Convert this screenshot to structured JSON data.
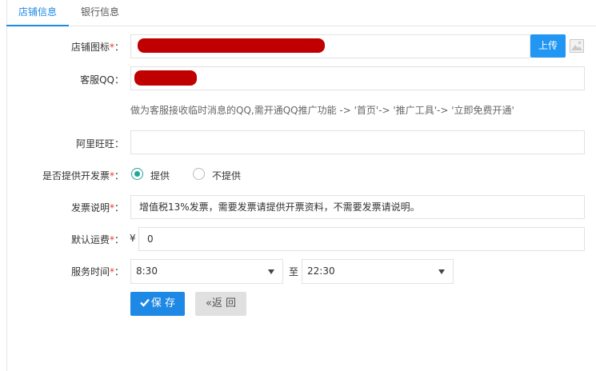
{
  "tabs": [
    {
      "label": "店铺信息",
      "active": true
    },
    {
      "label": "银行信息",
      "active": false
    }
  ],
  "form": {
    "store_icon": {
      "label": "店铺图标",
      "required_mark": "*",
      "colon": "：",
      "value": "",
      "upload_label": "上传"
    },
    "customer_qq": {
      "label": "客服QQ",
      "colon": "：",
      "value": "",
      "help": "做为客服接收临时消息的QQ,需开通QQ推广功能 -> '首页'-> '推广工具'-> '立即免费开通'"
    },
    "aliwangwang": {
      "label": "阿里旺旺",
      "colon": "：",
      "value": ""
    },
    "invoice": {
      "label": "是否提供开发票",
      "required_mark": "*",
      "colon": "：",
      "options": [
        "提供",
        "不提供"
      ],
      "selected": "提供"
    },
    "invoice_note": {
      "label": "发票说明",
      "required_mark": "*",
      "colon": "：",
      "value": "增值税13%发票，需要发票请提供开票资料，不需要发票请说明。"
    },
    "default_shipping": {
      "label": "默认运费",
      "required_mark": "*",
      "colon": "：",
      "currency": "¥",
      "value": "0"
    },
    "service_time": {
      "label": "服务时间",
      "required_mark": "*",
      "colon": "：",
      "start": "8:30",
      "separator": "至",
      "end": "22:30"
    }
  },
  "actions": {
    "save_label": "保 存",
    "back_label": "«返 回"
  },
  "colors": {
    "accent": "#1e88e5",
    "radio": "#26a69a",
    "required": "#e53935",
    "redaction": "#c00000"
  },
  "icons": {
    "upload_preview": "image-icon",
    "save": "check-icon"
  }
}
